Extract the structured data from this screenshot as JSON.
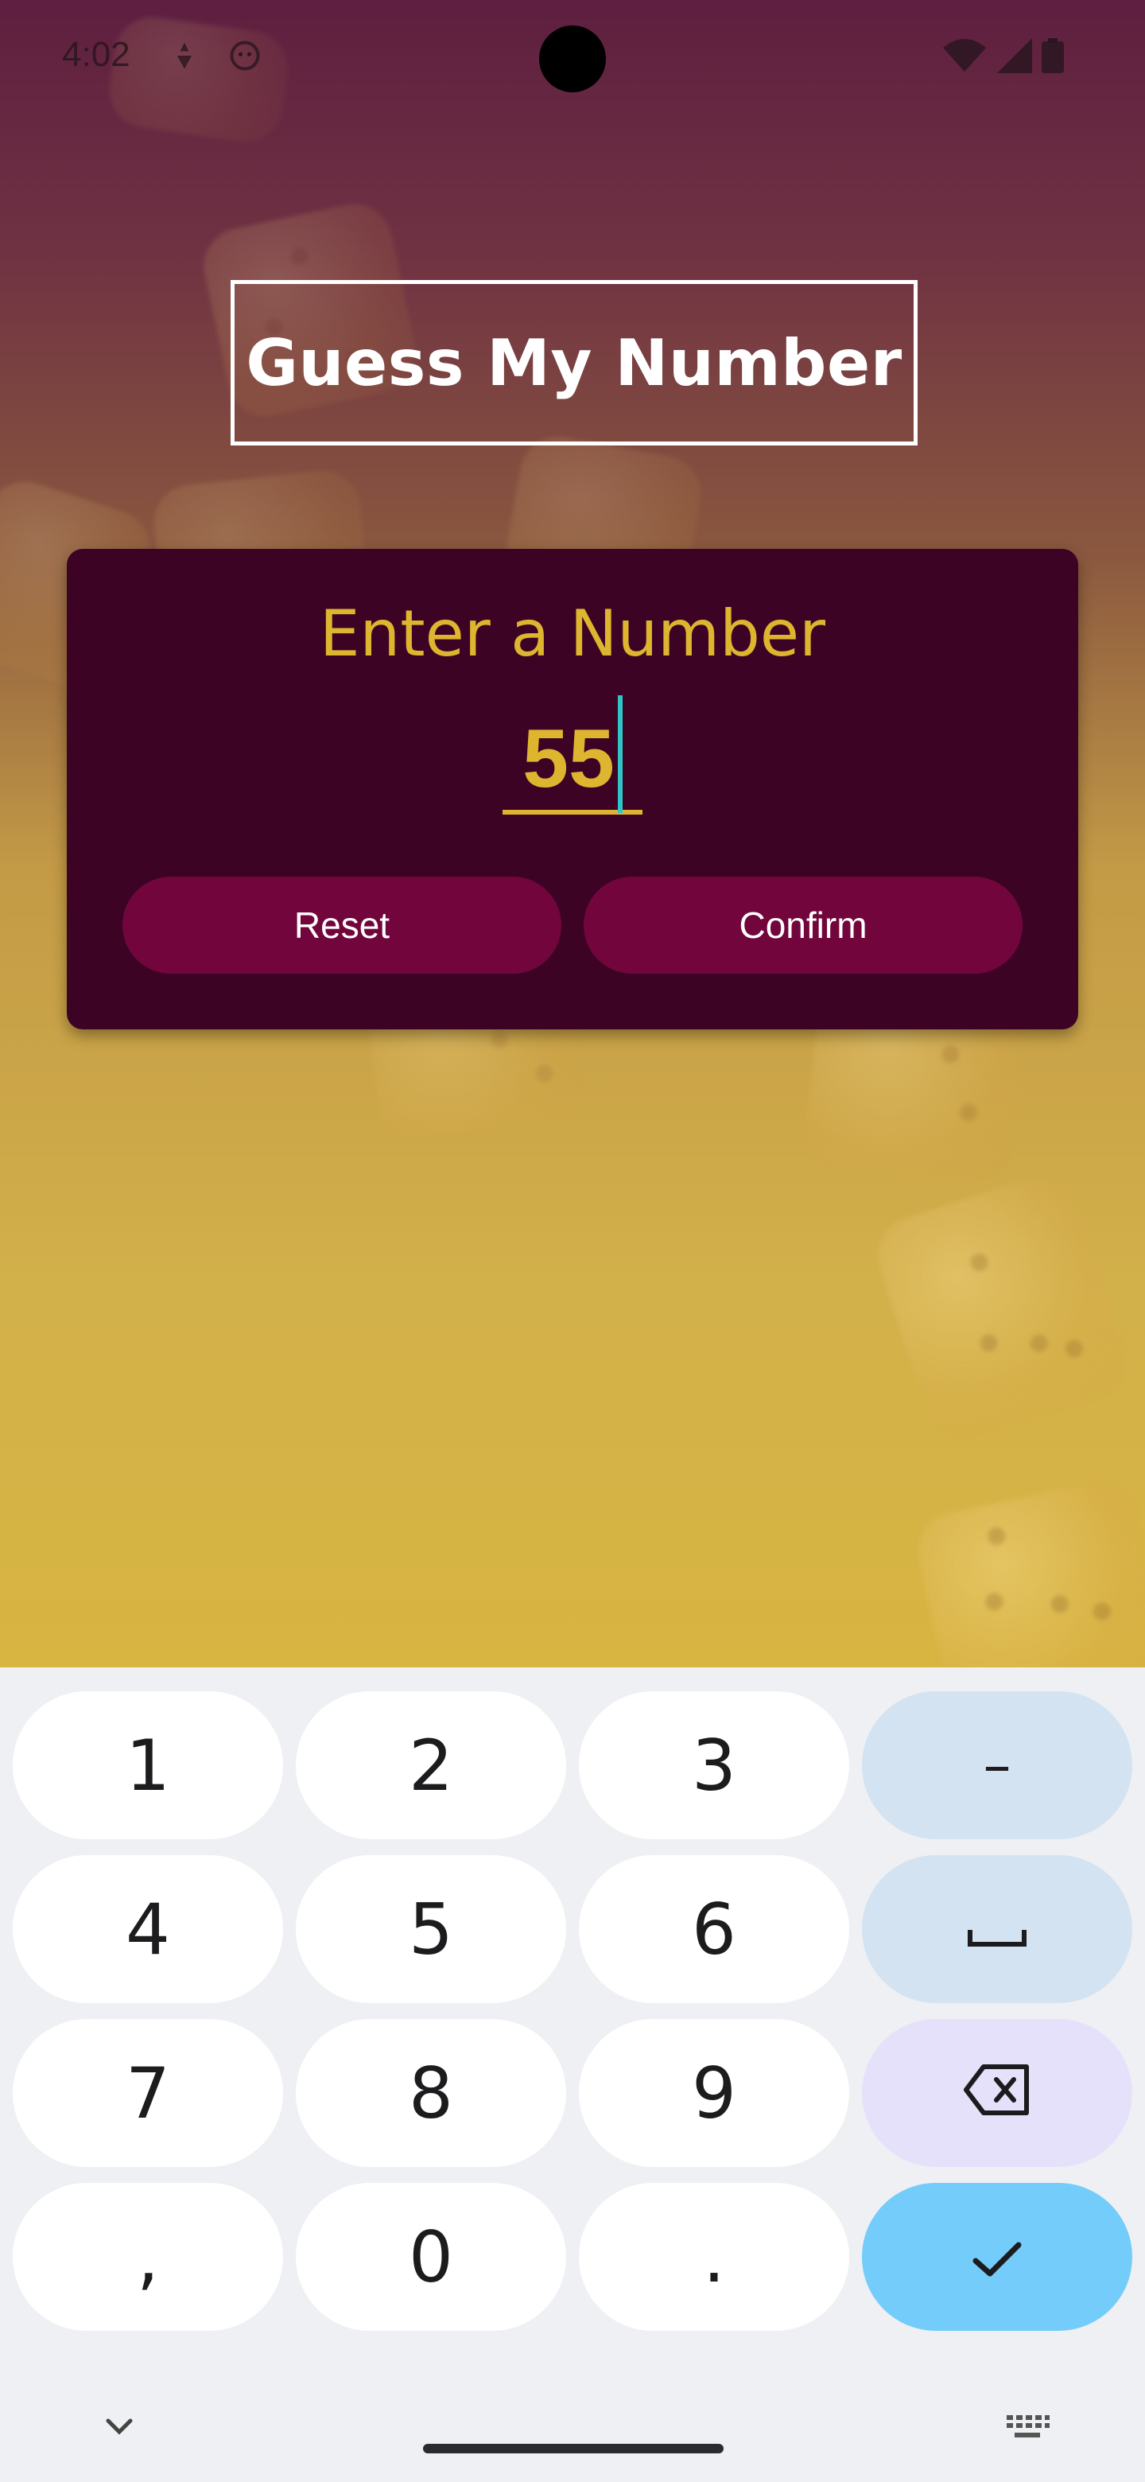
{
  "status_bar": {
    "time": "4:02",
    "left_icons": [
      "navigation-icon",
      "face-icon"
    ],
    "right_icons": [
      "wifi-icon",
      "signal-icon",
      "battery-icon"
    ]
  },
  "app": {
    "title": "Guess My Number",
    "card": {
      "label": "Enter a Number",
      "input_value": "55",
      "reset_label": "Reset",
      "confirm_label": "Confirm"
    },
    "colors": {
      "accent": "#ddb52f",
      "card_bg": "#3d0325",
      "button_bg": "#72063c",
      "caret": "#2fc6c8"
    }
  },
  "keyboard": {
    "rows": [
      [
        "1",
        "2",
        "3",
        "–"
      ],
      [
        "4",
        "5",
        "6",
        "␣"
      ],
      [
        "7",
        "8",
        "9",
        "⌫"
      ],
      [
        ",",
        "0",
        ".",
        "✓"
      ]
    ],
    "icons": [
      "minus-icon",
      "space-icon",
      "backspace-icon",
      "check-icon",
      "chevron-down-icon",
      "keyboard-icon"
    ]
  }
}
